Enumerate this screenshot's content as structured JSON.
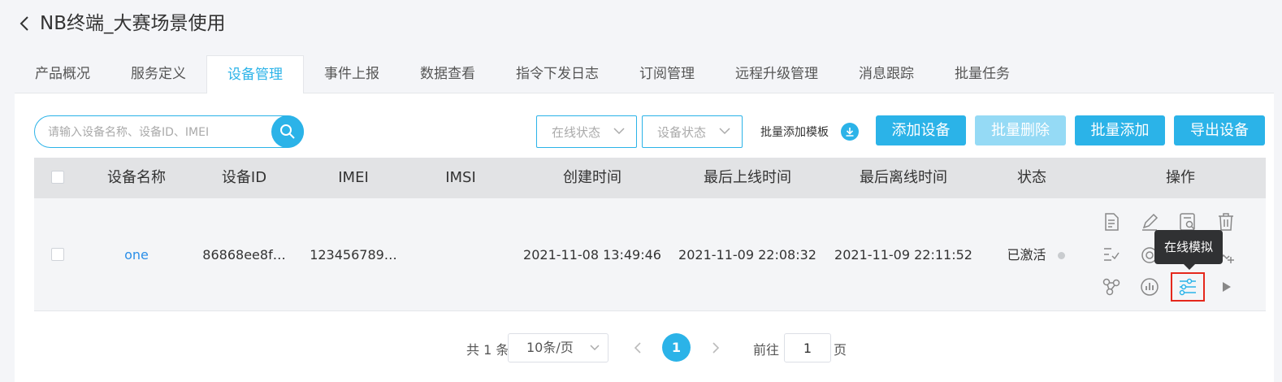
{
  "header": {
    "title": "NB终端_大赛场景使用"
  },
  "tabs": [
    {
      "label": "产品概况"
    },
    {
      "label": "服务定义"
    },
    {
      "label": "设备管理"
    },
    {
      "label": "事件上报"
    },
    {
      "label": "数据查看"
    },
    {
      "label": "指令下发日志"
    },
    {
      "label": "订阅管理"
    },
    {
      "label": "远程升级管理"
    },
    {
      "label": "消息跟踪"
    },
    {
      "label": "批量任务"
    }
  ],
  "active_tab": "设备管理",
  "toolbar": {
    "search_placeholder": "请输入设备名称、设备ID、IMEI",
    "online_status_placeholder": "在线状态",
    "device_status_placeholder": "设备状态",
    "template_label": "批量添加模板",
    "add_device": "添加设备",
    "batch_delete": "批量删除",
    "batch_add": "批量添加",
    "export_devices": "导出设备"
  },
  "table": {
    "columns": [
      "设备名称",
      "设备ID",
      "IMEI",
      "IMSI",
      "创建时间",
      "最后上线时间",
      "最后离线时间",
      "状态",
      "操作"
    ],
    "rows": [
      {
        "name": "one",
        "device_id": "86868ee8f…",
        "imei": "123456789…",
        "imsi": "",
        "created": "2021-11-08 13:49:46",
        "last_online": "2021-11-09 22:08:32",
        "last_offline": "2021-11-09 22:11:52",
        "status": "已激活"
      }
    ]
  },
  "operation_icons": [
    "document-icon",
    "edit-icon",
    "search-document-icon",
    "delete-icon",
    "checklist-icon",
    "refresh-icon",
    "image-add-icon",
    "topology-icon",
    "chart-icon",
    "simulate-icon",
    "play-icon"
  ],
  "tooltip": {
    "text": "在线模拟"
  },
  "pagination": {
    "total": "共 1 条",
    "page_size": "10条/页",
    "current_page": "1",
    "goto_label": "前往",
    "goto_value": "1",
    "page_unit": "页"
  },
  "colors": {
    "accent": "#2bb3e8",
    "accent_disabled": "#95daf5",
    "highlight": "#e5281c"
  }
}
